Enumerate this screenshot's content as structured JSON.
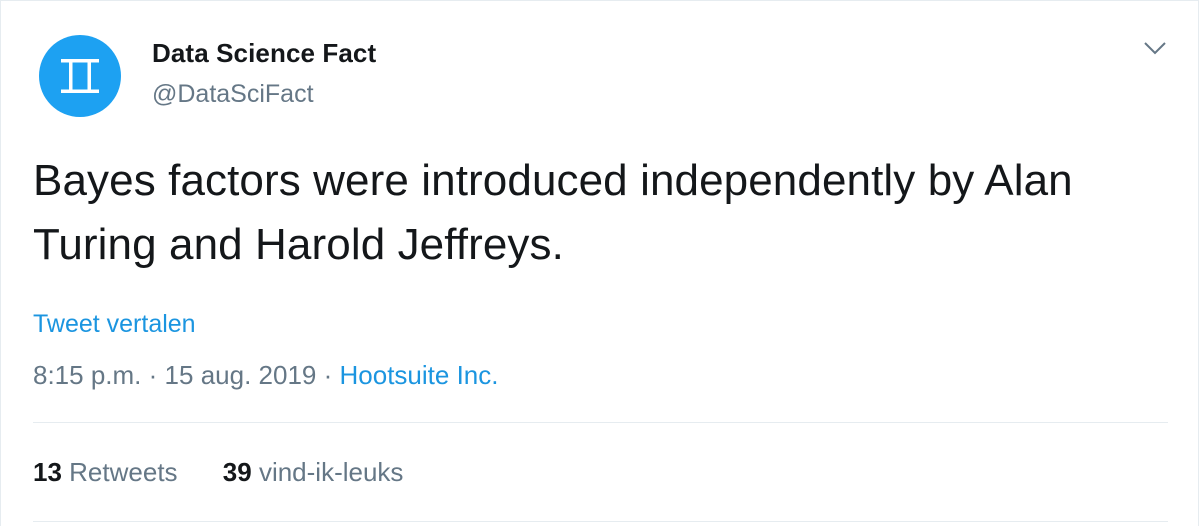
{
  "author": {
    "name": "Data Science Fact",
    "handle": "@DataSciFact",
    "avatar_glyph": "Π",
    "avatar_color": "#1da1f2"
  },
  "menu_icon": "chevron-down-icon",
  "tweet": {
    "text": "Bayes factors were introduced independently by Alan Turing and Harold Jeffreys.",
    "translate_label": "Tweet vertalen",
    "time": "8:15 p.m.",
    "separator": "·",
    "date": "15 aug. 2019",
    "source": "Hootsuite Inc."
  },
  "stats": {
    "retweets_count": "13",
    "retweets_label": "Retweets",
    "likes_count": "39",
    "likes_label": "vind-ik-leuks"
  },
  "colors": {
    "text_primary": "#14171a",
    "text_secondary": "#657786",
    "link": "#1b95e0",
    "divider": "#e6ecf0"
  }
}
